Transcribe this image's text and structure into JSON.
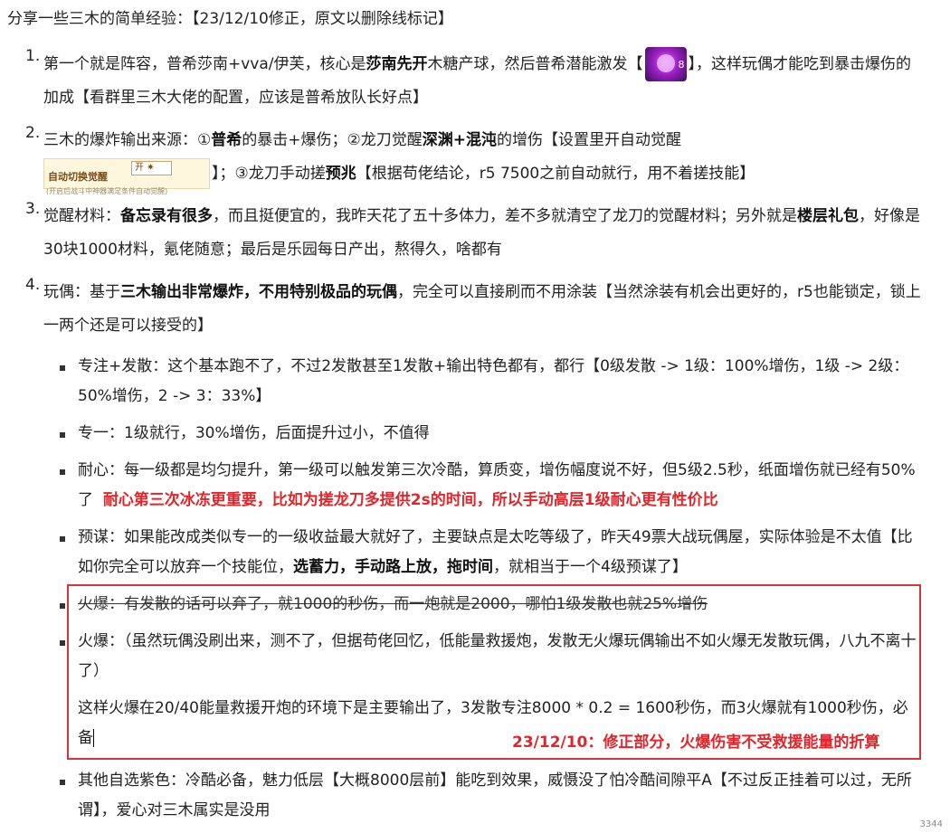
{
  "intro": "分享一些三木的简单经验：【23/12/10修正，原文以删除线标记】",
  "items": [
    {
      "num": "1.",
      "p1": "第一个就是阵容，普希莎南+vva/伊芙，核心是",
      "b1": "莎南先开",
      "p2": "木糖产球，然后普希潜能激发【",
      "icon_level": "8",
      "p3": "】，这样玩偶才能吃到暴击爆伤的加成【看群里三木大佬的配置，应该是普希放队长好点】"
    },
    {
      "num": "2.",
      "p1": "三木的爆炸输出来源：①",
      "b1": "普希",
      "p2": "的暴击+爆伤；②龙刀觉醒",
      "b2": "深渊+混沌",
      "p3": "的增伤【设置里开自动觉醒",
      "switch_label": "自动切换觉醒",
      "switch_btn": "开 ✷",
      "switch_sub": "(开启后战斗中神器满足条件自动觉醒)",
      "p4": "】；③龙刀手动搓",
      "b3": "预兆",
      "p5": "【根据苟佬结论，r5 7500之前自动就行，用不着搓技能】"
    },
    {
      "num": "3.",
      "p1": "觉醒材料：",
      "b1": "备忘录有很多",
      "p2": "，而且挺便宜的，我昨天花了五十多体力，差不多就清空了龙刀的觉醒材料；另外就是",
      "b2": "楼层礼包",
      "p3": "，好像是30块1000材料，氪佬随意；最后是乐园每日产出，熬得久，啥都有"
    },
    {
      "num": "4.",
      "p1": "玩偶：基于",
      "b1": "三木输出非常爆炸，不用特别极品的玩偶",
      "p2": "，完全可以直接刷而不用涂装【当然涂装有机会出更好的，r5也能锁定，锁上一两个还是可以接受的】"
    }
  ],
  "sub": {
    "s1": "专注+发散：这个基本跑不了，不过2发散甚至1发散+输出特色都有，都行【0级发散 -> 1级：100%增伤，1级 -> 2级：50%增伤，2 -> 3：33%】",
    "s2": "专一：1级就行，30%增伤，后面提升过小，不值得",
    "s3a": "耐心：每一级都是均匀提升，第一级可以触发第三次冷酷，算质变，增伤幅度说不好，但5级2.5秒，纸面增伤就已经有50%了",
    "s3red": "耐心第三次冰冻更重要，比如为搓龙刀多提供2s的时间，所以手动高层1级耐心更有性价比",
    "s4a": "预谋：如果能改成类似专一的一级收益最大就好了，主要缺点是太吃等级了，昨天49票大战玩偶屋，实际体验是不太值【比如你完全可以放弃一个技能位，",
    "s4b": "选蓄力，手动路上放，拖时间",
    "s4c": "，就相当于一个4级预谋了】",
    "s5": "火爆：有发散的话可以弃了，就1000的秒伤，而一炮就是2000，哪怕1级发散也就25%增伤",
    "s6": "火爆：（虽然玩偶没刷出来，测不了，但据苟佬回忆，低能量救援炮，发散无火爆玩偶输出不如火爆无发散玩偶，八九不离十了）",
    "s6b": "这样火爆在20/40能量救援开炮的环境下是主要输出了，3发散专注8000 * 0.2 = 1600秒伤，而3火爆就有1000秒伤，必备",
    "note": "23/12/10：修正部分，火爆伤害不受救援能量的折算",
    "s7": "其他自选紫色：冷酷必备，魅力低层【大概8000层前】能吃到效果，威慑没了怕冷酷间隙平A【不过反正挂着可以过，无所谓】，爱心对三木属实是没用"
  },
  "page_no": "3344"
}
